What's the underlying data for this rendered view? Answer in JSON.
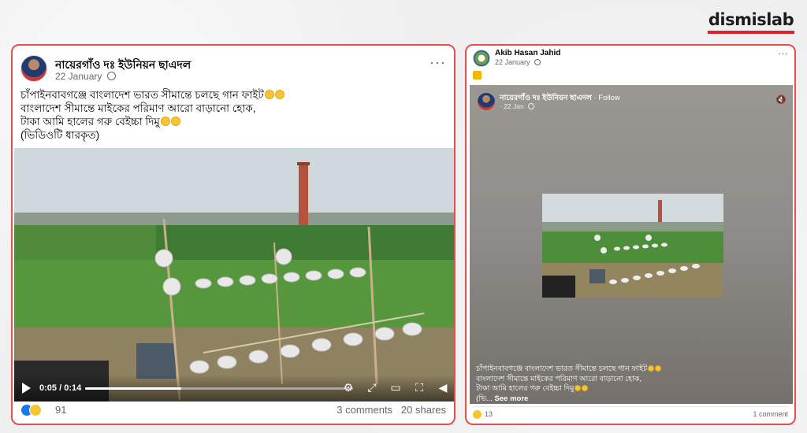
{
  "brand": {
    "logo_text": "dismislab",
    "accent_color": "#d9232e"
  },
  "left_post": {
    "page_name": "নায়েরগাঁও দঃ ইউনিয়ন ছাএদল",
    "date": "22 January",
    "privacy_icon": "globe-icon",
    "more_icon": "more-horizontal-icon",
    "text_lines": [
      "চাঁপাইনবাবগঞ্জে বাংলাদেশ ভারত সীমান্তে চলছে গান ফাইট",
      "বাংলাদেশ সীমান্তে মাইকের পরিমাণ আরো বাড়ানো হোক,",
      "টাকা আমি হালের গরু বেইচ্চা দিমু",
      "(ভিডিওটি ধারকৃত)"
    ],
    "video": {
      "current_time": "0:05",
      "separator": "/",
      "duration": "0:14",
      "progress_fraction": 0.36,
      "controls": [
        "settings-icon",
        "fullscreen-icon",
        "pip-icon",
        "expand-icon",
        "volume-icon"
      ]
    },
    "reactions": {
      "icons": [
        "like-icon",
        "haha-icon"
      ],
      "count": "91"
    },
    "comments": "3 comments",
    "shares": "20 shares"
  },
  "right_post": {
    "author": "Akib Hasan Jahid",
    "date": "22 January",
    "privacy_icon": "globe-icon",
    "more_icon": "more-horizontal-icon",
    "reel": {
      "page_name": "নায়েরগাঁও দঃ ইউনিয়ন ছাএদল",
      "follow_text": " · Follow",
      "date": "22 Jan",
      "mute_icon": "mute-icon",
      "caption_lines": [
        "চাঁপাইনবাবগঞ্জে বাংলাদেশ ভারত সীমান্তে চলছে গান ফাইট",
        "বাংলাদেশ সীমান্তে মাইকের পরিমাণ আরো বাড়ানো হোক,",
        "টাকা আমি হালের গরু বেইচ্চা দিমু"
      ],
      "caption_tail": "(ভি...",
      "see_more": "See more"
    },
    "reactions": {
      "icons": [
        "haha-icon"
      ],
      "count": "13"
    },
    "comments": "1 comment"
  }
}
